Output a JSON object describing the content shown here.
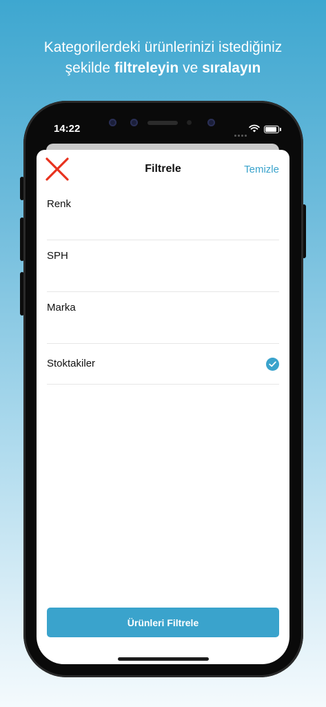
{
  "headline": {
    "line1": "Kategorilerdeki ürünlerinizi istediğiniz",
    "line2_pre": "şekilde ",
    "line2_bold1": "filtreleyin",
    "line2_mid": " ve ",
    "line2_bold2": "sıralayın"
  },
  "status_bar": {
    "time": "14:22"
  },
  "header": {
    "title": "Filtrele",
    "clear_label": "Temizle",
    "close_icon": "close-x-icon",
    "close_color": "#e8321e"
  },
  "filters": [
    {
      "label": "Renk"
    },
    {
      "label": "SPH"
    },
    {
      "label": "Marka"
    }
  ],
  "in_stock": {
    "label": "Stoktakiler",
    "checked": true
  },
  "apply_button": {
    "label": "Ürünleri Filtrele"
  },
  "colors": {
    "accent": "#3aa3cc",
    "close": "#e8321e"
  }
}
